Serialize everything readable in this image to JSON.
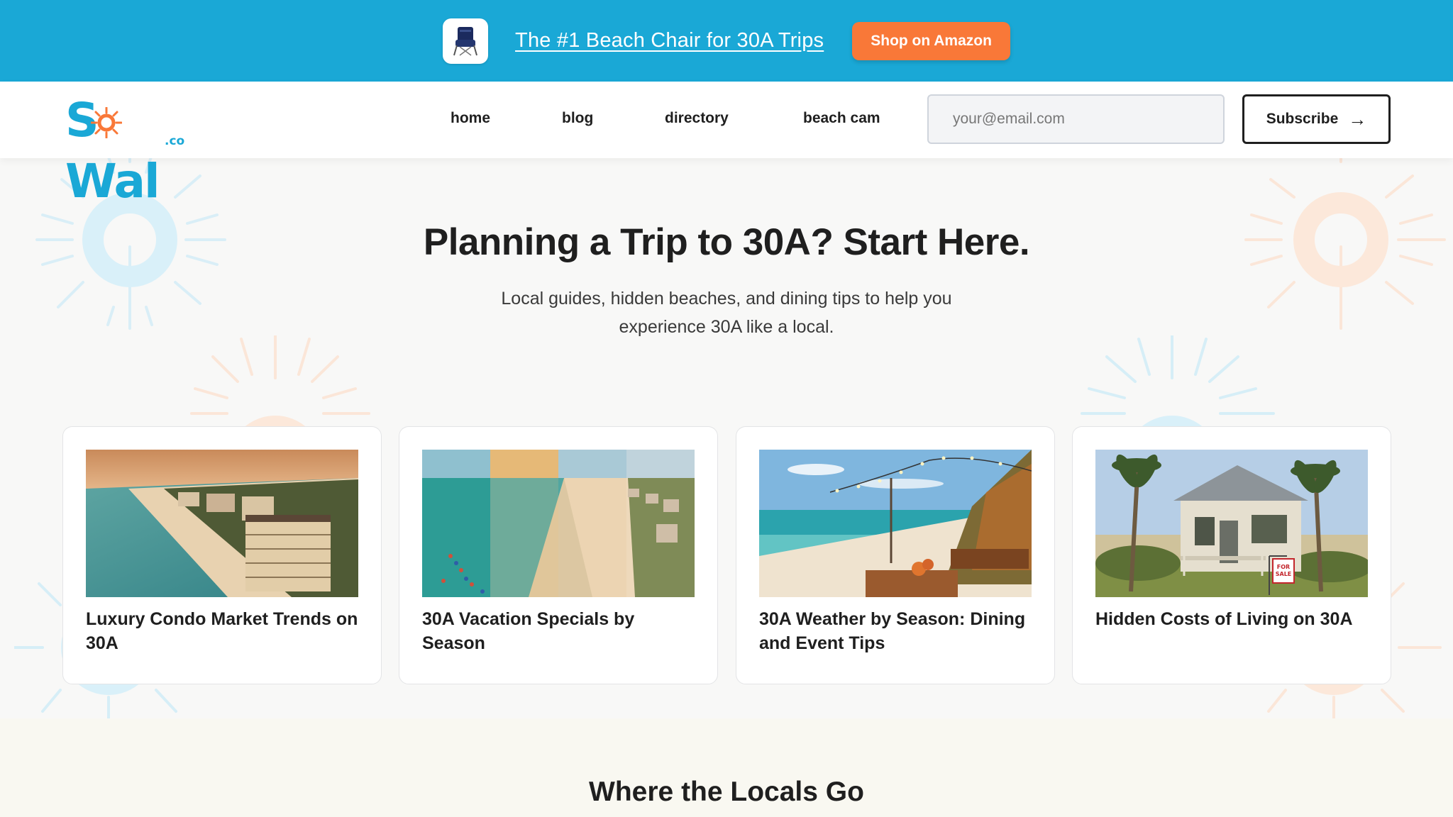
{
  "promo": {
    "icon": "beach-chair-icon",
    "link_text": "The #1 Beach Chair for 30A Trips",
    "button_label": "Shop on Amazon",
    "background": "#1aa8d6",
    "button_color": "#f97838"
  },
  "header": {
    "logo_text": "SoWal",
    "logo_suffix": ".co",
    "nav": [
      "home",
      "blog",
      "directory",
      "beach cam"
    ],
    "email_placeholder": "your@email.com",
    "subscribe_label": "Subscribe",
    "subscribe_icon": "arrow-right-icon"
  },
  "hero": {
    "title": "Planning a Trip to 30A? Start Here.",
    "subtitle": "Local guides, hidden beaches, and dining tips to help you experience 30A like a local."
  },
  "cards": [
    {
      "title": "Luxury Condo Market Trends on 30A",
      "image": "beachfront-condos-aerial"
    },
    {
      "title": "30A Vacation Specials by Season",
      "image": "beach-seasons-panorama"
    },
    {
      "title": "30A Weather by Season: Dining and Event Tips",
      "image": "beach-dining-string-lights"
    },
    {
      "title": "Hidden Costs of Living on 30A",
      "image": "beach-cottage-for-sale",
      "sign_text": "FOR SALE"
    }
  ],
  "locals": {
    "title": "Where the Locals Go"
  },
  "colors": {
    "brand_blue": "#1aa8d6",
    "accent_orange": "#f97838",
    "text_dark": "#1f1f1f"
  }
}
